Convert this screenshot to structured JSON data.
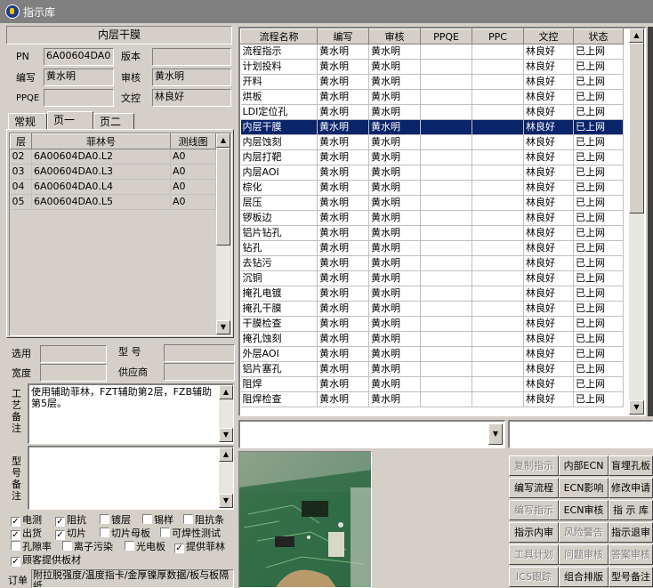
{
  "window": {
    "title": "指示库"
  },
  "header": {
    "panel_title": "内层干膜",
    "pn_label": "PN",
    "pn_value": "6A00604DA0",
    "version_label": "版本",
    "version_value": "",
    "author_label": "编写",
    "author_value": "黄水明",
    "reviewer_label": "审核",
    "reviewer_value": "黄水明",
    "ppqe_label": "PPQE",
    "ppqe_value": "",
    "doc_label": "文控",
    "doc_value": "林良好"
  },
  "tabs": [
    "常规",
    "页一",
    "页二"
  ],
  "layer_table": {
    "columns": [
      "层",
      "菲林号",
      "测线图"
    ],
    "rows": [
      [
        "02",
        "6A00604DA0.L2",
        "A0"
      ],
      [
        "03",
        "6A00604DA0.L3",
        "A0"
      ],
      [
        "04",
        "6A00604DA0.L4",
        "A0"
      ],
      [
        "05",
        "6A00604DA0.L5",
        "A0"
      ]
    ]
  },
  "form": {
    "select_label": "选用",
    "model_label": "型 号",
    "width_label": "宽度",
    "supplier_label": "供应商",
    "process_note_label": "工艺备注",
    "process_note": "使用辅助菲林，FZT辅助第2层，FZB辅助第5层。",
    "model_note_label": "型号备注"
  },
  "checkboxes": {
    "row1": [
      {
        "label": "电测",
        "checked": true
      },
      {
        "label": "阻抗",
        "checked": true
      },
      {
        "label": "镀层",
        "checked": false
      },
      {
        "label": "锡样",
        "checked": false
      },
      {
        "label": "阻抗条",
        "checked": false
      }
    ],
    "row2": [
      {
        "label": "出货",
        "checked": true
      },
      {
        "label": "切片",
        "checked": true
      },
      {
        "label": "切片母板",
        "checked": false
      },
      {
        "label": "可焊性测试",
        "checked": false
      }
    ],
    "row3": [
      {
        "label": "孔隙率",
        "checked": false
      },
      {
        "label": "离子污染",
        "checked": false
      },
      {
        "label": "光电板",
        "checked": false
      },
      {
        "label": "提供菲林",
        "checked": true
      }
    ],
    "row4": [
      {
        "label": "顾客提供板材",
        "checked": true
      }
    ]
  },
  "order_note": {
    "label": "订单",
    "text": "附拉脱强度/温度指卡/金厚镍厚数据/板与板隔纸"
  },
  "process_table": {
    "columns": [
      "流程名称",
      "编写",
      "审核",
      "PPQE",
      "PPC",
      "文控",
      "状态"
    ],
    "selected_index": 5,
    "rows": [
      [
        "流程指示",
        "黄水明",
        "黄水明",
        "",
        "",
        "林良好",
        "已上网"
      ],
      [
        "计划投料",
        "黄水明",
        "黄水明",
        "",
        "",
        "林良好",
        "已上网"
      ],
      [
        "开料",
        "黄水明",
        "黄水明",
        "",
        "",
        "林良好",
        "已上网"
      ],
      [
        "烘板",
        "黄水明",
        "黄水明",
        "",
        "",
        "林良好",
        "已上网"
      ],
      [
        "LDI定位孔",
        "黄水明",
        "黄水明",
        "",
        "",
        "林良好",
        "已上网"
      ],
      [
        "内层干膜",
        "黄水明",
        "黄水明",
        "",
        "",
        "林良好",
        "已上网"
      ],
      [
        "内层蚀刻",
        "黄水明",
        "黄水明",
        "",
        "",
        "林良好",
        "已上网"
      ],
      [
        "内层打靶",
        "黄水明",
        "黄水明",
        "",
        "",
        "林良好",
        "已上网"
      ],
      [
        "内层AOI",
        "黄水明",
        "黄水明",
        "",
        "",
        "林良好",
        "已上网"
      ],
      [
        "棕化",
        "黄水明",
        "黄水明",
        "",
        "",
        "林良好",
        "已上网"
      ],
      [
        "层压",
        "黄水明",
        "黄水明",
        "",
        "",
        "林良好",
        "已上网"
      ],
      [
        "锣板边",
        "黄水明",
        "黄水明",
        "",
        "",
        "林良好",
        "已上网"
      ],
      [
        "铝片钻孔",
        "黄水明",
        "黄水明",
        "",
        "",
        "林良好",
        "已上网"
      ],
      [
        "钻孔",
        "黄水明",
        "黄水明",
        "",
        "",
        "林良好",
        "已上网"
      ],
      [
        "去钻污",
        "黄水明",
        "黄水明",
        "",
        "",
        "林良好",
        "已上网"
      ],
      [
        "沉铜",
        "黄水明",
        "黄水明",
        "",
        "",
        "林良好",
        "已上网"
      ],
      [
        "掩孔电镀",
        "黄水明",
        "黄水明",
        "",
        "",
        "林良好",
        "已上网"
      ],
      [
        "掩孔干膜",
        "黄水明",
        "黄水明",
        "",
        "",
        "林良好",
        "已上网"
      ],
      [
        "干膜检查",
        "黄水明",
        "黄水明",
        "",
        "",
        "林良好",
        "已上网"
      ],
      [
        "掩孔蚀刻",
        "黄水明",
        "黄水明",
        "",
        "",
        "林良好",
        "已上网"
      ],
      [
        "外层AOI",
        "黄水明",
        "黄水明",
        "",
        "",
        "林良好",
        "已上网"
      ],
      [
        "铝片塞孔",
        "黄水明",
        "黄水明",
        "",
        "",
        "林良好",
        "已上网"
      ],
      [
        "阻焊",
        "黄水明",
        "黄水明",
        "",
        "",
        "林良好",
        "已上网"
      ],
      [
        "阻焊检查",
        "黄水明",
        "黄水明",
        "",
        "",
        "林良好",
        "已上网"
      ]
    ]
  },
  "buttons": [
    [
      {
        "label": "复制指示",
        "enabled": false
      },
      {
        "label": "内部ECN",
        "enabled": true
      },
      {
        "label": "盲埋孔板",
        "enabled": true
      }
    ],
    [
      {
        "label": "编写流程",
        "enabled": true
      },
      {
        "label": "ECN影响",
        "enabled": true
      },
      {
        "label": "修改申请",
        "enabled": true
      }
    ],
    [
      {
        "label": "编写指示",
        "enabled": false
      },
      {
        "label": "ECN审核",
        "enabled": true
      },
      {
        "label": "指 示 库",
        "enabled": true
      }
    ],
    [
      {
        "label": "指示内审",
        "enabled": true
      },
      {
        "label": "风险警告",
        "enabled": false
      },
      {
        "label": "指示退审",
        "enabled": true
      }
    ],
    [
      {
        "label": "工具计划",
        "enabled": false
      },
      {
        "label": "问题审核",
        "enabled": false
      },
      {
        "label": "答案审核",
        "enabled": false
      }
    ],
    [
      {
        "label": "ICS跟踪",
        "enabled": false
      },
      {
        "label": "组合排版",
        "enabled": true
      },
      {
        "label": "型号备注",
        "enabled": true
      }
    ]
  ],
  "colors": {
    "selection": "#0a246a",
    "window_bg": "#d4d0c8",
    "titlebar": "#808080"
  }
}
